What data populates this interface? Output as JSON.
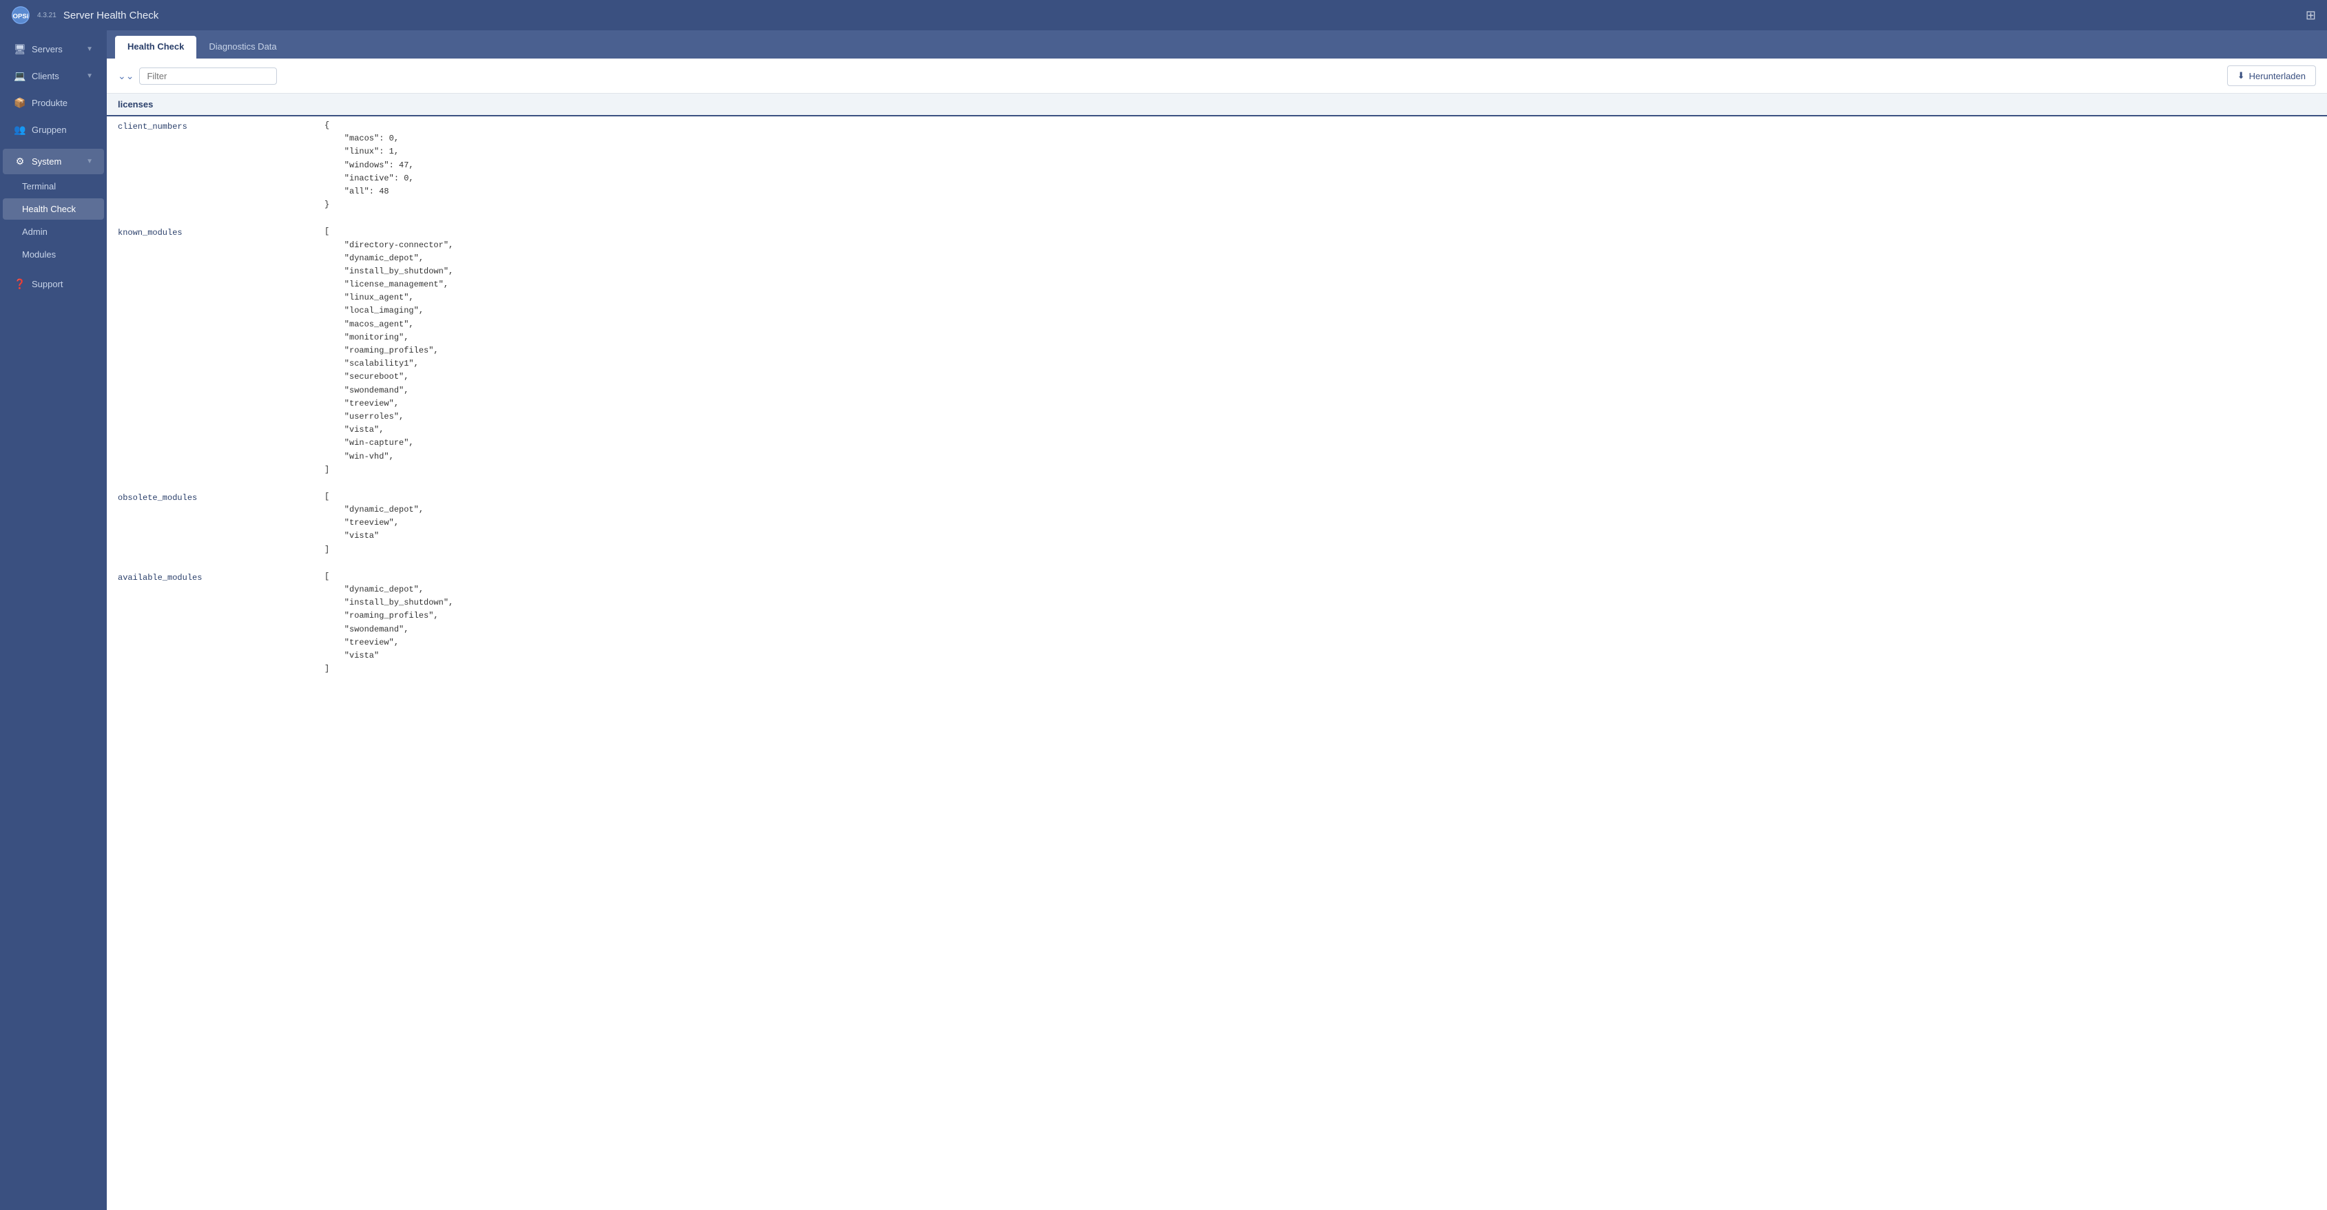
{
  "app": {
    "name": "OPSi",
    "version": "4.3.21",
    "title": "Server Health Check",
    "grid_icon": "⊞"
  },
  "sidebar": {
    "items": [
      {
        "id": "servers",
        "label": "Servers",
        "icon": "🖥",
        "has_sub": true
      },
      {
        "id": "clients",
        "label": "Clients",
        "icon": "💻",
        "has_sub": true
      },
      {
        "id": "produkte",
        "label": "Produkte",
        "icon": "📦",
        "has_sub": false
      },
      {
        "id": "gruppen",
        "label": "Gruppen",
        "icon": "👥",
        "has_sub": false
      }
    ],
    "system_section": "System",
    "sub_items": [
      {
        "id": "terminal",
        "label": "Terminal",
        "active": false
      },
      {
        "id": "health-check",
        "label": "Health Check",
        "active": true
      },
      {
        "id": "admin",
        "label": "Admin",
        "active": false
      },
      {
        "id": "modules",
        "label": "Modules",
        "active": false
      }
    ],
    "support": "Support"
  },
  "tabs": [
    {
      "id": "health-check",
      "label": "Health Check",
      "active": true
    },
    {
      "id": "diagnostics-data",
      "label": "Diagnostics Data",
      "active": false
    }
  ],
  "filter": {
    "placeholder": "Filter",
    "value": ""
  },
  "download_btn": "Herunterladen",
  "section": {
    "name": "licenses"
  },
  "data_rows": [
    {
      "key": "client_numbers",
      "value": "{\n    \"macos\": 0,\n    \"linux\": 1,\n    \"windows\": 47,\n    \"inactive\": 0,\n    \"all\": 48\n}"
    },
    {
      "key": "known_modules",
      "value": "[\n    \"directory-connector\",\n    \"dynamic_depot\",\n    \"install_by_shutdown\",\n    \"license_management\",\n    \"linux_agent\",\n    \"local_imaging\",\n    \"macos_agent\",\n    \"monitoring\",\n    \"roaming_profiles\",\n    \"scalability1\",\n    \"secureboot\",\n    \"swondemand\",\n    \"treeview\",\n    \"userroles\",\n    \"vista\",\n    \"win-capture\",\n    \"win-vhd\",\n]"
    },
    {
      "key": "obsolete_modules",
      "value": "[\n    \"dynamic_depot\",\n    \"treeview\",\n    \"vista\"\n]"
    },
    {
      "key": "available_modules",
      "value": "[\n    \"dynamic_depot\",\n    \"install_by_shutdown\",\n    \"roaming_profiles\",\n    \"swondemand\",\n    \"treeview\",\n    \"vista\"\n]"
    }
  ]
}
